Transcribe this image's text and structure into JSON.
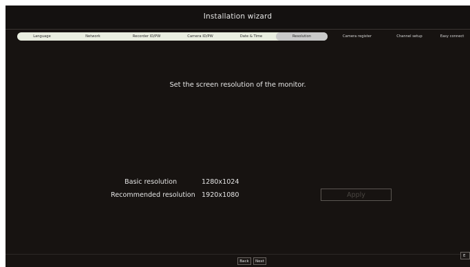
{
  "window": {
    "title": "Installation wizard"
  },
  "steps": [
    {
      "label": "Language"
    },
    {
      "label": "Network"
    },
    {
      "label": "Recorder ID/PW"
    },
    {
      "label": "Camera ID/PW"
    },
    {
      "label": "Date & Time"
    },
    {
      "label": "Resolution"
    },
    {
      "label": "Camera register"
    },
    {
      "label": "Channel setup"
    },
    {
      "label": "Easy connect"
    }
  ],
  "current_step": "Resolution",
  "main": {
    "instruction": "Set the screen resolution of the monitor.",
    "basic_label": "Basic resolution",
    "basic_value": "1280x1024",
    "recommended_label": "Recommended resolution",
    "recommended_value": "1920x1080",
    "apply_label": "Apply"
  },
  "footer": {
    "back_label": "Back",
    "next_label": "Next",
    "edge_label": "E"
  }
}
